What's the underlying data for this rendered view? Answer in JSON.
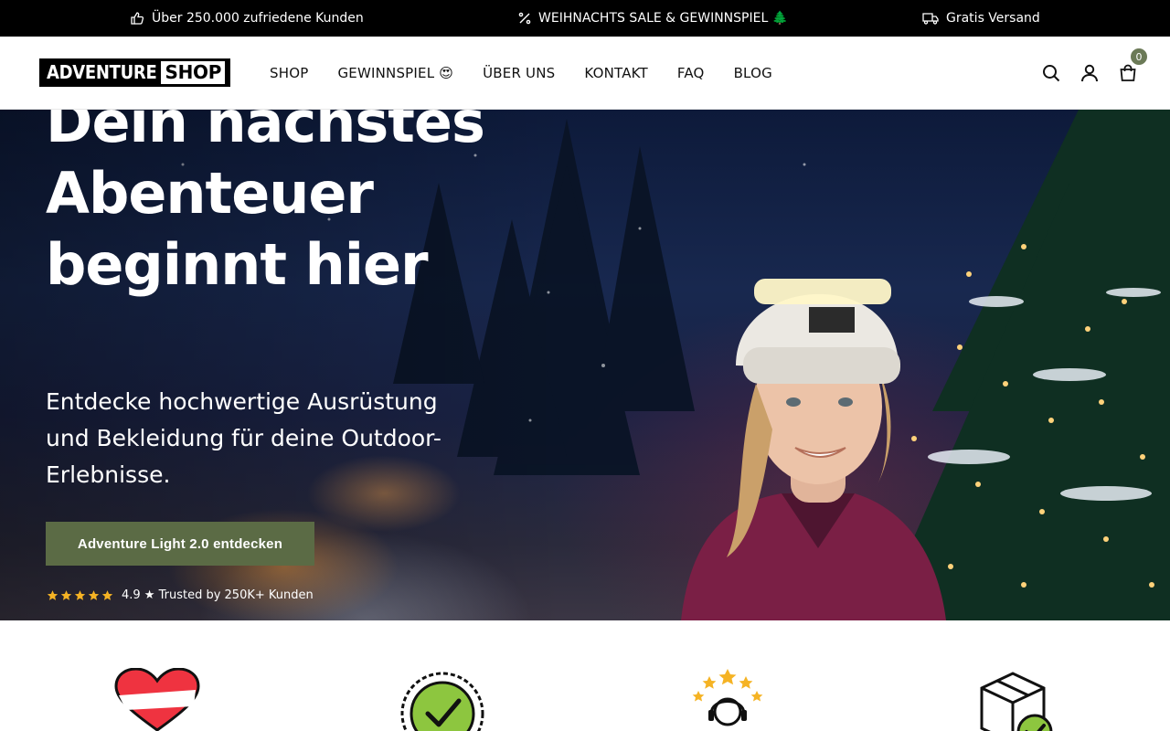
{
  "announcement": {
    "customers_text": "Über 250.000 zufriedene Kunden",
    "sale_text": "WEIHNACHTS SALE & GEWINNSPIEL 🌲",
    "shipping_text": "Gratis Versand",
    "icons": [
      "thumbs-up-icon",
      "percent-icon",
      "truck-icon"
    ]
  },
  "header": {
    "logo_part1": "ADVENTURE",
    "logo_part2": "SHOP",
    "nav": [
      {
        "label": "SHOP"
      },
      {
        "label": "GEWINNSPIEL 😍"
      },
      {
        "label": "ÜBER UNS"
      },
      {
        "label": "KONTAKT"
      },
      {
        "label": "FAQ"
      },
      {
        "label": "BLOG"
      }
    ],
    "cart_count": "0",
    "icons": [
      "search-icon",
      "account-icon",
      "cart-icon"
    ],
    "badge_color": "#6b7a57"
  },
  "hero": {
    "title": "Dein nächstes Abenteuer beginnt hier",
    "subtitle": "Entdecke hochwertige Ausrüstung und Bekleidung für deine Outdoor-Erlebnisse.",
    "cta_label": "Adventure Light 2.0 entdecken",
    "cta_color": "#5b6b45",
    "rating_text": "4.9 ★ Trusted by 250K+ Kunden",
    "rating_stars": 5,
    "star_color": "#f5b324"
  },
  "features": {
    "icons": [
      "austria-heart-icon",
      "quality-check-badge-icon",
      "customer-support-stars-icon",
      "package-delivery-icon"
    ]
  }
}
